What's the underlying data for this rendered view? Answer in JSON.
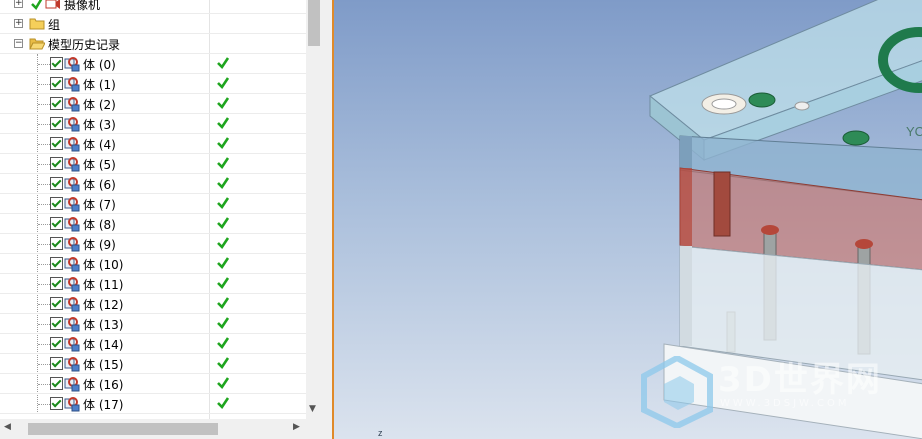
{
  "tree": {
    "top_items": [
      {
        "label": "摄像机"
      },
      {
        "label": "组"
      },
      {
        "label": "模型历史记录"
      }
    ],
    "bodies": [
      {
        "label": "体 (0)"
      },
      {
        "label": "体 (1)"
      },
      {
        "label": "体 (2)"
      },
      {
        "label": "体 (3)"
      },
      {
        "label": "体 (4)"
      },
      {
        "label": "体 (5)"
      },
      {
        "label": "体 (6)"
      },
      {
        "label": "体 (7)"
      },
      {
        "label": "体 (8)"
      },
      {
        "label": "体 (9)"
      },
      {
        "label": "体 (10)"
      },
      {
        "label": "体 (11)"
      },
      {
        "label": "体 (12)"
      },
      {
        "label": "体 (13)"
      },
      {
        "label": "体 (14)"
      },
      {
        "label": "体 (15)"
      },
      {
        "label": "体 (16)"
      },
      {
        "label": "体 (17)"
      }
    ]
  },
  "viewport": {
    "model_text": "YC",
    "watermark": "3D世界网",
    "watermark_sub": "WWW.3DSJW.COM"
  },
  "colors": {
    "check_green": "#1fa51f",
    "splitter_accent": "#e08a2a",
    "mold_plate": "#a8cfe0",
    "mold_red": "#b5473a"
  }
}
